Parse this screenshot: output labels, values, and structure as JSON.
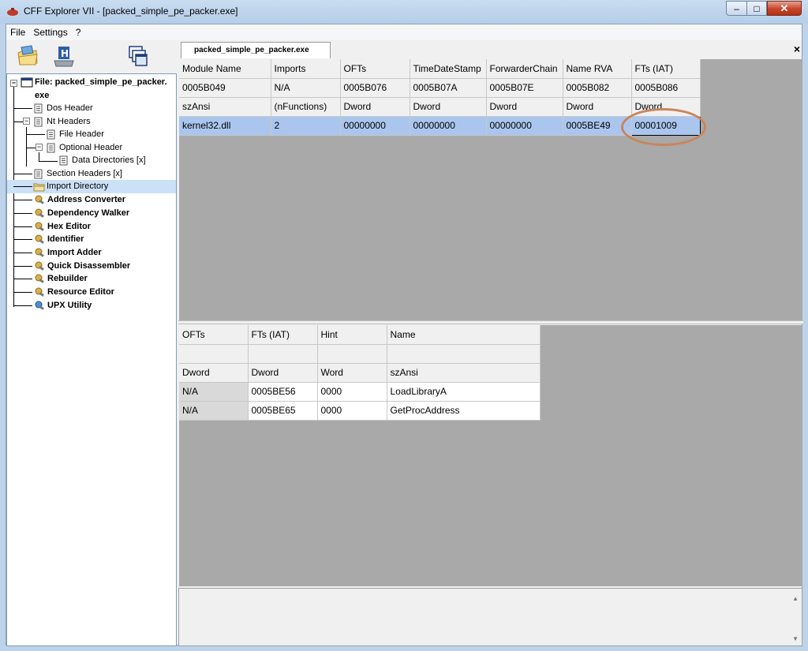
{
  "window": {
    "title": "CFF Explorer VII - [packed_simple_pe_packer.exe]",
    "minimize_label": "–",
    "maximize_label": "□",
    "close_label": "✕"
  },
  "menu": [
    "File",
    "Settings",
    "?"
  ],
  "toolbar": {
    "icons": [
      "open-folder-icon",
      "save-disk-icon",
      "windows-cascade-icon"
    ]
  },
  "tree": {
    "root_line1": "File: packed_simple_pe_packer.",
    "root_line2": "exe",
    "items": [
      "Dos Header",
      "Nt Headers",
      "File Header",
      "Optional Header",
      "Data Directories [x]",
      "Section Headers [x]",
      "Import Directory",
      "Address Converter",
      "Dependency Walker",
      "Hex Editor",
      "Identifier",
      "Import Adder",
      "Quick Disassembler",
      "Rebuilder",
      "Resource Editor",
      "UPX Utility"
    ],
    "selected": "Import Directory"
  },
  "tab": {
    "label": "packed_simple_pe_packer.exe",
    "close_label": "×"
  },
  "imports_table": {
    "headers": [
      "Module Name",
      "Imports",
      "OFTs",
      "TimeDateStamp",
      "ForwarderChain",
      "Name RVA",
      "FTs (IAT)"
    ],
    "offsets": [
      "0005B049",
      "N/A",
      "0005B076",
      "0005B07A",
      "0005B07E",
      "0005B082",
      "0005B086"
    ],
    "types": [
      "szAnsi",
      "(nFunctions)",
      "Dword",
      "Dword",
      "Dword",
      "Dword",
      "Dword"
    ],
    "rows": [
      [
        "kernel32.dll",
        "2",
        "00000000",
        "00000000",
        "00000000",
        "0005BE49",
        "00001009"
      ]
    ]
  },
  "functions_table": {
    "headers": [
      "OFTs",
      "FTs (IAT)",
      "Hint",
      "Name"
    ],
    "offsets": [
      "",
      "",
      "",
      ""
    ],
    "types": [
      "Dword",
      "Dword",
      "Word",
      "szAnsi"
    ],
    "rows": [
      [
        "N/A",
        "0005BE56",
        "0000",
        "LoadLibraryA"
      ],
      [
        "N/A",
        "0005BE65",
        "0000",
        "GetProcAddress"
      ]
    ]
  },
  "colors": {
    "selection": "#aac6ee",
    "grid_background": "#a9a9a9",
    "annotation_ellipse": "#c8855c"
  }
}
